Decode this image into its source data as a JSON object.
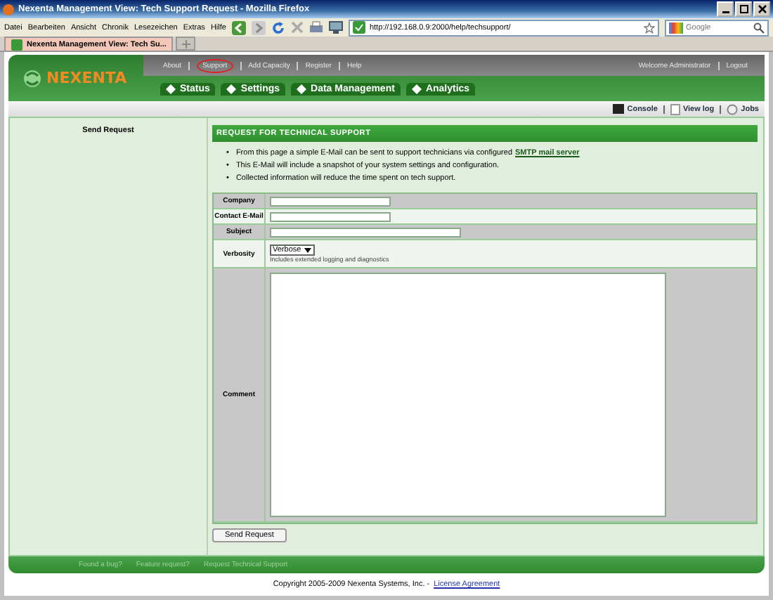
{
  "window": {
    "title": "Nexenta Management View: Tech Support Request - Mozilla Firefox"
  },
  "menu": [
    "Datei",
    "Bearbeiten",
    "Ansicht",
    "Chronik",
    "Lesezeichen",
    "Extras",
    "Hilfe"
  ],
  "address_bar": {
    "value": "http://192.168.0.9:2000/help/techsupport/"
  },
  "search": {
    "placeholder": "Google"
  },
  "tabs": [
    {
      "label": "Nexenta Management View: Tech Su...",
      "selected": true
    }
  ],
  "app": {
    "logo": "NEXENTA",
    "top_links": [
      {
        "label": "About",
        "selected": false
      },
      {
        "label": "Support",
        "selected": true
      },
      {
        "label": "Add Capacity",
        "selected": false
      },
      {
        "label": "Register",
        "selected": false
      },
      {
        "label": "Help",
        "selected": false
      }
    ],
    "user_links": [
      "Welcome Administrator",
      "Logout"
    ],
    "nav": [
      "Status",
      "Settings",
      "Data Management",
      "Analytics"
    ],
    "tools": [
      {
        "label": "Console",
        "kind": "console"
      },
      {
        "label": "View log",
        "kind": "log"
      },
      {
        "label": "Jobs",
        "kind": "jobs"
      }
    ]
  },
  "sidebar": {
    "items": [
      "Send Request"
    ]
  },
  "panel": {
    "title": "REQUEST FOR TECHNICAL SUPPORT",
    "bullets": [
      {
        "marker": "•",
        "text": "From this page a simple E-Mail can be sent to support technicians via configured",
        "link": "SMTP mail server"
      },
      {
        "marker": "•",
        "text": "This E-Mail will include a snapshot of your system settings and configuration."
      },
      {
        "marker": "•",
        "text": "Collected information will reduce the time spent on tech support."
      }
    ]
  },
  "form": {
    "fields": [
      {
        "label": "Company",
        "kind": "text"
      },
      {
        "label": "Contact E-Mail",
        "kind": "text"
      },
      {
        "label": "Subject",
        "kind": "wide"
      },
      {
        "label": "Verbosity",
        "kind": "select",
        "value": "Verbose",
        "hint": "Includes extended logging and diagnostics"
      },
      {
        "label": "Comment",
        "kind": "textarea"
      }
    ],
    "submit": "Send Request"
  },
  "footer": {
    "links": [
      "Found a bug?",
      "Feature request?",
      "Request Technical Support"
    ],
    "copyright": "Copyright 2005-2009 Nexenta Systems, Inc. -",
    "license_link": "License Agreement"
  }
}
